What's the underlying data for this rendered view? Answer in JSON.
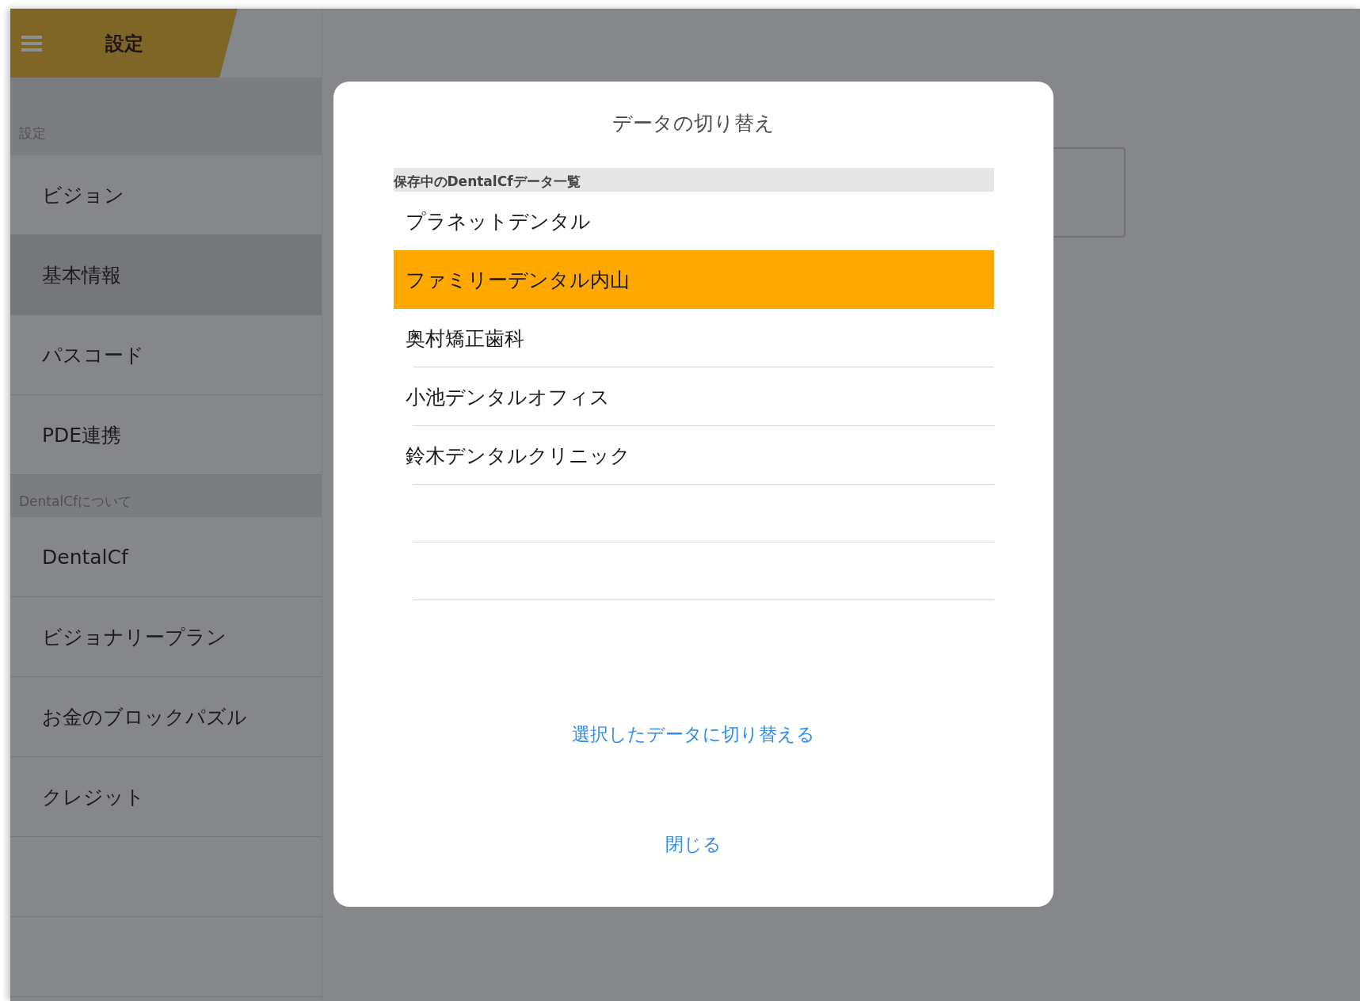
{
  "header": {
    "title": "設定"
  },
  "sidebar": {
    "sections": [
      {
        "title": "設定",
        "items": [
          {
            "label": "ビジョン",
            "selected": false
          },
          {
            "label": "基本情報",
            "selected": true
          },
          {
            "label": "パスコード",
            "selected": false
          },
          {
            "label": "PDE連携",
            "selected": false
          }
        ]
      },
      {
        "title": "DentalCfについて",
        "items": [
          {
            "label": "DentalCf",
            "selected": false
          },
          {
            "label": "ビジョナリープラン",
            "selected": false
          },
          {
            "label": "お金のブロックパズル",
            "selected": false
          },
          {
            "label": "クレジット",
            "selected": false
          }
        ]
      }
    ]
  },
  "dialog": {
    "title": "データの切り替え",
    "list_header": "保存中のDentalCfデータ一覧",
    "items": [
      {
        "label": "プラネットデンタル",
        "selected": false
      },
      {
        "label": "ファミリーデンタル内山",
        "selected": true
      },
      {
        "label": "奥村矯正歯科",
        "selected": false
      },
      {
        "label": "小池デンタルオフィス",
        "selected": false
      },
      {
        "label": "鈴木デンタルクリニック",
        "selected": false
      }
    ],
    "switch_button": "選択したデータに切り替える",
    "close_button": "閉じる"
  }
}
